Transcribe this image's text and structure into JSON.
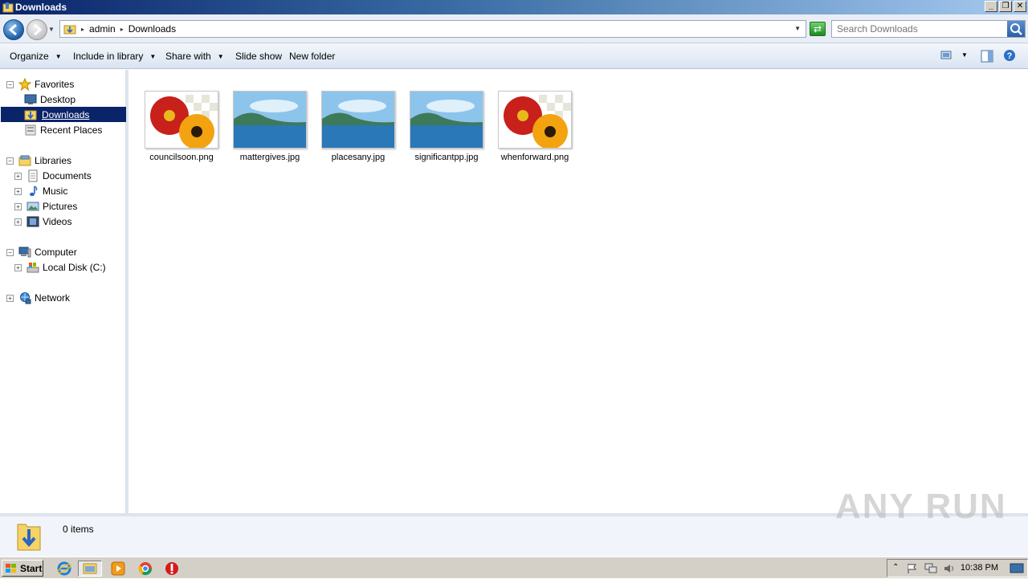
{
  "window": {
    "title": "Downloads"
  },
  "address": {
    "crumbs": [
      "admin",
      "Downloads"
    ]
  },
  "search": {
    "placeholder": "Search Downloads"
  },
  "toolbar": {
    "organize": "Organize",
    "include_in_library": "Include in library",
    "share_with": "Share with",
    "slide_show": "Slide show",
    "new_folder": "New folder"
  },
  "nav": {
    "favorites": "Favorites",
    "desktop": "Desktop",
    "downloads": "Downloads",
    "recent_places": "Recent Places",
    "libraries": "Libraries",
    "documents": "Documents",
    "music": "Music",
    "pictures": "Pictures",
    "videos": "Videos",
    "computer": "Computer",
    "local_disk": "Local Disk (C:)",
    "network": "Network"
  },
  "files": [
    {
      "name": "councilsoon.png",
      "thumb": "flower"
    },
    {
      "name": "mattergives.jpg",
      "thumb": "landscape"
    },
    {
      "name": "placesany.jpg",
      "thumb": "landscape"
    },
    {
      "name": "significantpp.jpg",
      "thumb": "landscape"
    },
    {
      "name": "whenforward.png",
      "thumb": "flower"
    }
  ],
  "details": {
    "count": "0 items"
  },
  "watermark": "ANY RUN",
  "taskbar": {
    "start": "Start",
    "clock": "10:38 PM"
  },
  "colors": {
    "selection": "#0a246a",
    "title_start": "#0a246a",
    "title_end": "#a6caf0"
  }
}
